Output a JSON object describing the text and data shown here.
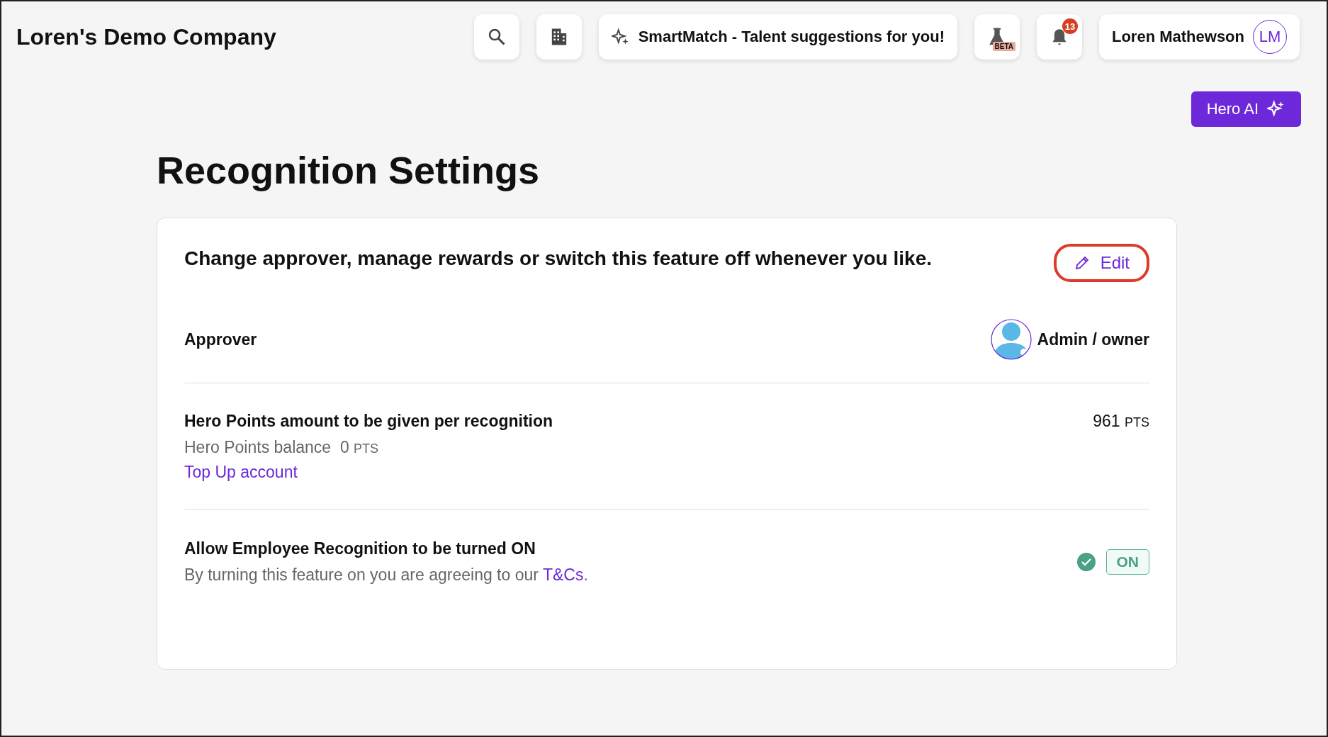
{
  "header": {
    "company": "Loren's Demo Company",
    "smartmatch": "SmartMatch - Talent suggestions for you!",
    "beta_badge": "BETA",
    "notification_count": "13",
    "user_name": "Loren Mathewson",
    "user_initials": "LM"
  },
  "hero_ai": {
    "label": "Hero AI"
  },
  "page_title": "Recognition Settings",
  "card": {
    "intro": "Change approver, manage rewards or switch this feature off whenever you like.",
    "edit": {
      "label": "Edit",
      "highlighted": true
    },
    "approver": {
      "label": "Approver",
      "value": "Admin / owner"
    },
    "points": {
      "label": "Hero Points amount to be given per recognition",
      "amount": "961",
      "amount_unit": "PTS",
      "balance_label": "Hero Points balance",
      "balance": "0",
      "balance_unit": "PTS",
      "link": "Top Up account"
    },
    "allow": {
      "label": "Allow Employee Recognition to be turned ON",
      "text": "By turning this feature on you are agreeing to our",
      "link": "T&Cs",
      "after_link": ".",
      "toggle": {
        "label": "ON",
        "on": true
      }
    }
  }
}
